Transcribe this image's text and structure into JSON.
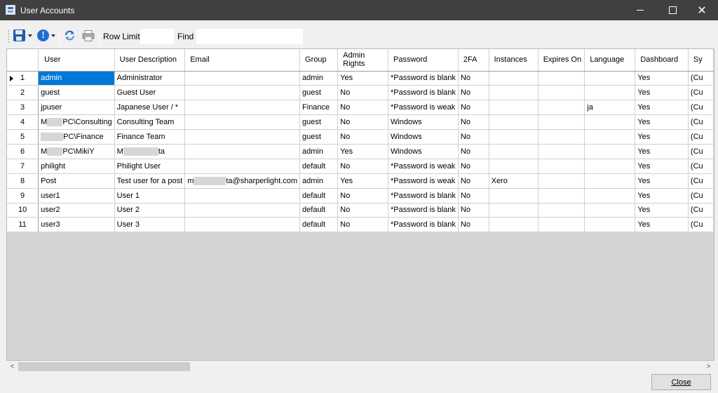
{
  "window": {
    "title": "User Accounts",
    "close_glyph": "✕"
  },
  "toolbar": {
    "save_icon": "save-icon",
    "info_icon": "info-icon",
    "info_glyph": "!",
    "refresh_icon": "refresh-icon",
    "print_icon": "print-icon",
    "row_limit_label": "Row Limit",
    "row_limit_value": "",
    "find_label": "Find",
    "find_value": ""
  },
  "grid": {
    "columns": [
      "User",
      "User Description",
      "Email",
      "Group",
      "Admin Rights",
      "Password",
      "2FA",
      "Instances",
      "Expires On",
      "Language",
      "Dashboard",
      "Sy"
    ],
    "rows": [
      {
        "num": "1",
        "user": "admin",
        "desc": "Administrator",
        "email": "",
        "group": "admin",
        "admin": "Yes",
        "password": "*Password is blank",
        "tfa": "No",
        "instances": "",
        "expires": "",
        "language": "",
        "dashboard": "Yes",
        "sy": "(Cu"
      },
      {
        "num": "2",
        "user": "guest",
        "desc": "Guest User",
        "email": "",
        "group": "guest",
        "admin": "No",
        "password": "*Password is blank",
        "tfa": "No",
        "instances": "",
        "expires": "",
        "language": "",
        "dashboard": "Yes",
        "sy": "(Cu"
      },
      {
        "num": "3",
        "user": "jpuser",
        "desc": "Japanese User / *",
        "email": "",
        "group": "Finance",
        "admin": "No",
        "password": "*Password is weak",
        "tfa": "No",
        "instances": "",
        "expires": "",
        "language": "ja",
        "dashboard": "Yes",
        "sy": "(Cu"
      },
      {
        "num": "4",
        "user_prefix": "M",
        "user_suffix": "PC\\Consulting",
        "desc": "Consulting Team",
        "email": "",
        "group": "guest",
        "admin": "No",
        "password": "Windows",
        "tfa": "No",
        "instances": "",
        "expires": "",
        "language": "",
        "dashboard": "Yes",
        "sy": "(Cu"
      },
      {
        "num": "5",
        "user_prefix": "",
        "user_suffix": "PC\\Finance",
        "desc": "Finance Team",
        "email": "",
        "group": "guest",
        "admin": "No",
        "password": "Windows",
        "tfa": "No",
        "instances": "",
        "expires": "",
        "language": "",
        "dashboard": "Yes",
        "sy": "(Cu"
      },
      {
        "num": "6",
        "user_prefix": "M",
        "user_suffix": "PC\\MikiY",
        "desc_prefix": "M",
        "desc_suffix": "ta",
        "email": "",
        "group": "admin",
        "admin": "Yes",
        "password": "Windows",
        "tfa": "No",
        "instances": "",
        "expires": "",
        "language": "",
        "dashboard": "Yes",
        "sy": "(Cu"
      },
      {
        "num": "7",
        "user": "philight",
        "desc": "Philight User",
        "email": "",
        "group": "default",
        "admin": "No",
        "password": "*Password is weak",
        "tfa": "No",
        "instances": "",
        "expires": "",
        "language": "",
        "dashboard": "Yes",
        "sy": "(Cu"
      },
      {
        "num": "8",
        "user": "Post",
        "desc": "Test user for a post",
        "email_prefix": "m",
        "email_suffix": "ta@sharperlight.com",
        "group": "admin",
        "admin": "Yes",
        "password": "*Password is weak",
        "tfa": "No",
        "instances": "Xero",
        "expires": "",
        "language": "",
        "dashboard": "Yes",
        "sy": "(Cu"
      },
      {
        "num": "9",
        "user": "user1",
        "desc": "User 1",
        "email": "",
        "group": "default",
        "admin": "No",
        "password": "*Password is blank",
        "tfa": "No",
        "instances": "",
        "expires": "",
        "language": "",
        "dashboard": "Yes",
        "sy": "(Cu"
      },
      {
        "num": "10",
        "user": "user2",
        "desc": "User 2",
        "email": "",
        "group": "default",
        "admin": "No",
        "password": "*Password is blank",
        "tfa": "No",
        "instances": "",
        "expires": "",
        "language": "",
        "dashboard": "Yes",
        "sy": "(Cu"
      },
      {
        "num": "11",
        "user": "user3",
        "desc": "User 3",
        "email": "",
        "group": "default",
        "admin": "No",
        "password": "*Password is blank",
        "tfa": "No",
        "instances": "",
        "expires": "",
        "language": "",
        "dashboard": "Yes",
        "sy": "(Cu"
      }
    ]
  },
  "scrollbar": {
    "left_arrow": "<",
    "right_arrow": ">"
  },
  "footer": {
    "close_label": "Close"
  }
}
